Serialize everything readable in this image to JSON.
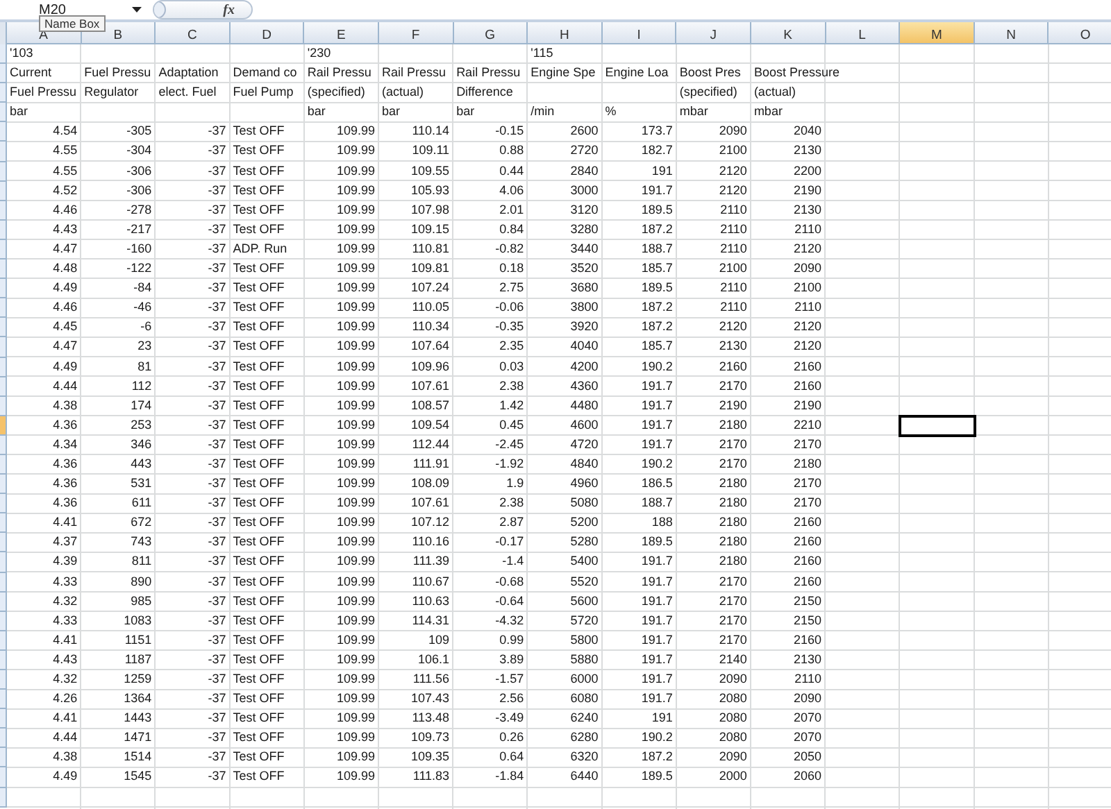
{
  "formula_bar": {
    "name_box": "M20",
    "function_label": "fx"
  },
  "tooltip": "Name Box",
  "columns": [
    {
      "label": "A",
      "selected": false
    },
    {
      "label": "B",
      "selected": false
    },
    {
      "label": "C",
      "selected": false
    },
    {
      "label": "D",
      "selected": false
    },
    {
      "label": "E",
      "selected": false
    },
    {
      "label": "F",
      "selected": false
    },
    {
      "label": "G",
      "selected": false
    },
    {
      "label": "H",
      "selected": false
    },
    {
      "label": "I",
      "selected": false
    },
    {
      "label": "J",
      "selected": false
    },
    {
      "label": "K",
      "selected": false
    },
    {
      "label": "L",
      "selected": false
    },
    {
      "label": "M",
      "selected": true
    },
    {
      "label": "N",
      "selected": false
    },
    {
      "label": "O",
      "selected": false
    }
  ],
  "rows": [
    {
      "selected": false,
      "cells": {
        "A": "'103",
        "E": "'230",
        "H": "'115"
      }
    },
    {
      "selected": false,
      "cells": {
        "A": "Current",
        "B": "Fuel Pressu",
        "C": "Adaptation",
        "D": "Demand co",
        "E": "Rail Pressu",
        "F": "Rail Pressu",
        "G": "Rail Pressu",
        "H": "Engine Spe",
        "I": "Engine Loa",
        "J": "Boost Pres",
        "K": "Boost Pressure"
      }
    },
    {
      "selected": false,
      "cells": {
        "A": "Fuel Pressu",
        "B": "Regulator",
        "C": "elect. Fuel",
        "D": "Fuel Pump",
        "E": "(specified)",
        "F": "(actual)",
        "G": "Difference",
        "J": "(specified)",
        "K": "(actual)"
      }
    },
    {
      "selected": false,
      "cells": {
        "A": "bar",
        "E": "bar",
        "F": "bar",
        "G": "bar",
        "H": "/min",
        "I": "%",
        "J": "mbar",
        "K": "mbar"
      }
    },
    {
      "selected": false,
      "cells": {
        "A": "4.54",
        "B": "-305",
        "C": "-37",
        "D": "Test OFF",
        "E": "109.99",
        "F": "110.14",
        "G": "-0.15",
        "H": "2600",
        "I": "173.7",
        "J": "2090",
        "K": "2040"
      }
    },
    {
      "selected": false,
      "cells": {
        "A": "4.55",
        "B": "-304",
        "C": "-37",
        "D": "Test OFF",
        "E": "109.99",
        "F": "109.11",
        "G": "0.88",
        "H": "2720",
        "I": "182.7",
        "J": "2100",
        "K": "2130"
      }
    },
    {
      "selected": false,
      "cells": {
        "A": "4.55",
        "B": "-306",
        "C": "-37",
        "D": "Test OFF",
        "E": "109.99",
        "F": "109.55",
        "G": "0.44",
        "H": "2840",
        "I": "191",
        "J": "2120",
        "K": "2200"
      }
    },
    {
      "selected": false,
      "cells": {
        "A": "4.52",
        "B": "-306",
        "C": "-37",
        "D": "Test OFF",
        "E": "109.99",
        "F": "105.93",
        "G": "4.06",
        "H": "3000",
        "I": "191.7",
        "J": "2120",
        "K": "2190"
      }
    },
    {
      "selected": false,
      "cells": {
        "A": "4.46",
        "B": "-278",
        "C": "-37",
        "D": "Test OFF",
        "E": "109.99",
        "F": "107.98",
        "G": "2.01",
        "H": "3120",
        "I": "189.5",
        "J": "2110",
        "K": "2130"
      }
    },
    {
      "selected": false,
      "cells": {
        "A": "4.43",
        "B": "-217",
        "C": "-37",
        "D": "Test OFF",
        "E": "109.99",
        "F": "109.15",
        "G": "0.84",
        "H": "3280",
        "I": "187.2",
        "J": "2110",
        "K": "2110"
      }
    },
    {
      "selected": false,
      "cells": {
        "A": "4.47",
        "B": "-160",
        "C": "-37",
        "D": "ADP. Run",
        "E": "109.99",
        "F": "110.81",
        "G": "-0.82",
        "H": "3440",
        "I": "188.7",
        "J": "2110",
        "K": "2120"
      }
    },
    {
      "selected": false,
      "cells": {
        "A": "4.48",
        "B": "-122",
        "C": "-37",
        "D": "Test OFF",
        "E": "109.99",
        "F": "109.81",
        "G": "0.18",
        "H": "3520",
        "I": "185.7",
        "J": "2100",
        "K": "2090"
      }
    },
    {
      "selected": false,
      "cells": {
        "A": "4.49",
        "B": "-84",
        "C": "-37",
        "D": "Test OFF",
        "E": "109.99",
        "F": "107.24",
        "G": "2.75",
        "H": "3680",
        "I": "189.5",
        "J": "2110",
        "K": "2100"
      }
    },
    {
      "selected": false,
      "cells": {
        "A": "4.46",
        "B": "-46",
        "C": "-37",
        "D": "Test OFF",
        "E": "109.99",
        "F": "110.05",
        "G": "-0.06",
        "H": "3800",
        "I": "187.2",
        "J": "2110",
        "K": "2110"
      }
    },
    {
      "selected": false,
      "cells": {
        "A": "4.45",
        "B": "-6",
        "C": "-37",
        "D": "Test OFF",
        "E": "109.99",
        "F": "110.34",
        "G": "-0.35",
        "H": "3920",
        "I": "187.2",
        "J": "2120",
        "K": "2120"
      }
    },
    {
      "selected": false,
      "cells": {
        "A": "4.47",
        "B": "23",
        "C": "-37",
        "D": "Test OFF",
        "E": "109.99",
        "F": "107.64",
        "G": "2.35",
        "H": "4040",
        "I": "185.7",
        "J": "2130",
        "K": "2120"
      }
    },
    {
      "selected": false,
      "cells": {
        "A": "4.49",
        "B": "81",
        "C": "-37",
        "D": "Test OFF",
        "E": "109.99",
        "F": "109.96",
        "G": "0.03",
        "H": "4200",
        "I": "190.2",
        "J": "2160",
        "K": "2160"
      }
    },
    {
      "selected": false,
      "cells": {
        "A": "4.44",
        "B": "112",
        "C": "-37",
        "D": "Test OFF",
        "E": "109.99",
        "F": "107.61",
        "G": "2.38",
        "H": "4360",
        "I": "191.7",
        "J": "2170",
        "K": "2160"
      }
    },
    {
      "selected": false,
      "cells": {
        "A": "4.38",
        "B": "174",
        "C": "-37",
        "D": "Test OFF",
        "E": "109.99",
        "F": "108.57",
        "G": "1.42",
        "H": "4480",
        "I": "191.7",
        "J": "2190",
        "K": "2190"
      }
    },
    {
      "selected": true,
      "cells": {
        "A": "4.36",
        "B": "253",
        "C": "-37",
        "D": "Test OFF",
        "E": "109.99",
        "F": "109.54",
        "G": "0.45",
        "H": "4600",
        "I": "191.7",
        "J": "2180",
        "K": "2210"
      }
    },
    {
      "selected": false,
      "cells": {
        "A": "4.34",
        "B": "346",
        "C": "-37",
        "D": "Test OFF",
        "E": "109.99",
        "F": "112.44",
        "G": "-2.45",
        "H": "4720",
        "I": "191.7",
        "J": "2170",
        "K": "2170"
      }
    },
    {
      "selected": false,
      "cells": {
        "A": "4.36",
        "B": "443",
        "C": "-37",
        "D": "Test OFF",
        "E": "109.99",
        "F": "111.91",
        "G": "-1.92",
        "H": "4840",
        "I": "190.2",
        "J": "2170",
        "K": "2180"
      }
    },
    {
      "selected": false,
      "cells": {
        "A": "4.36",
        "B": "531",
        "C": "-37",
        "D": "Test OFF",
        "E": "109.99",
        "F": "108.09",
        "G": "1.9",
        "H": "4960",
        "I": "186.5",
        "J": "2180",
        "K": "2170"
      }
    },
    {
      "selected": false,
      "cells": {
        "A": "4.36",
        "B": "611",
        "C": "-37",
        "D": "Test OFF",
        "E": "109.99",
        "F": "107.61",
        "G": "2.38",
        "H": "5080",
        "I": "188.7",
        "J": "2180",
        "K": "2170"
      }
    },
    {
      "selected": false,
      "cells": {
        "A": "4.41",
        "B": "672",
        "C": "-37",
        "D": "Test OFF",
        "E": "109.99",
        "F": "107.12",
        "G": "2.87",
        "H": "5200",
        "I": "188",
        "J": "2180",
        "K": "2160"
      }
    },
    {
      "selected": false,
      "cells": {
        "A": "4.37",
        "B": "743",
        "C": "-37",
        "D": "Test OFF",
        "E": "109.99",
        "F": "110.16",
        "G": "-0.17",
        "H": "5280",
        "I": "189.5",
        "J": "2180",
        "K": "2160"
      }
    },
    {
      "selected": false,
      "cells": {
        "A": "4.39",
        "B": "811",
        "C": "-37",
        "D": "Test OFF",
        "E": "109.99",
        "F": "111.39",
        "G": "-1.4",
        "H": "5400",
        "I": "191.7",
        "J": "2180",
        "K": "2160"
      }
    },
    {
      "selected": false,
      "cells": {
        "A": "4.33",
        "B": "890",
        "C": "-37",
        "D": "Test OFF",
        "E": "109.99",
        "F": "110.67",
        "G": "-0.68",
        "H": "5520",
        "I": "191.7",
        "J": "2170",
        "K": "2160"
      }
    },
    {
      "selected": false,
      "cells": {
        "A": "4.32",
        "B": "985",
        "C": "-37",
        "D": "Test OFF",
        "E": "109.99",
        "F": "110.63",
        "G": "-0.64",
        "H": "5600",
        "I": "191.7",
        "J": "2170",
        "K": "2150"
      }
    },
    {
      "selected": false,
      "cells": {
        "A": "4.33",
        "B": "1083",
        "C": "-37",
        "D": "Test OFF",
        "E": "109.99",
        "F": "114.31",
        "G": "-4.32",
        "H": "5720",
        "I": "191.7",
        "J": "2170",
        "K": "2150"
      }
    },
    {
      "selected": false,
      "cells": {
        "A": "4.41",
        "B": "1151",
        "C": "-37",
        "D": "Test OFF",
        "E": "109.99",
        "F": "109",
        "G": "0.99",
        "H": "5800",
        "I": "191.7",
        "J": "2170",
        "K": "2160"
      }
    },
    {
      "selected": false,
      "cells": {
        "A": "4.43",
        "B": "1187",
        "C": "-37",
        "D": "Test OFF",
        "E": "109.99",
        "F": "106.1",
        "G": "3.89",
        "H": "5880",
        "I": "191.7",
        "J": "2140",
        "K": "2130"
      }
    },
    {
      "selected": false,
      "cells": {
        "A": "4.32",
        "B": "1259",
        "C": "-37",
        "D": "Test OFF",
        "E": "109.99",
        "F": "111.56",
        "G": "-1.57",
        "H": "6000",
        "I": "191.7",
        "J": "2090",
        "K": "2110"
      }
    },
    {
      "selected": false,
      "cells": {
        "A": "4.26",
        "B": "1364",
        "C": "-37",
        "D": "Test OFF",
        "E": "109.99",
        "F": "107.43",
        "G": "2.56",
        "H": "6080",
        "I": "191.7",
        "J": "2080",
        "K": "2090"
      }
    },
    {
      "selected": false,
      "cells": {
        "A": "4.41",
        "B": "1443",
        "C": "-37",
        "D": "Test OFF",
        "E": "109.99",
        "F": "113.48",
        "G": "-3.49",
        "H": "6240",
        "I": "191",
        "J": "2080",
        "K": "2070"
      }
    },
    {
      "selected": false,
      "cells": {
        "A": "4.44",
        "B": "1471",
        "C": "-37",
        "D": "Test OFF",
        "E": "109.99",
        "F": "109.73",
        "G": "0.26",
        "H": "6280",
        "I": "190.2",
        "J": "2080",
        "K": "2070"
      }
    },
    {
      "selected": false,
      "cells": {
        "A": "4.38",
        "B": "1514",
        "C": "-37",
        "D": "Test OFF",
        "E": "109.99",
        "F": "109.35",
        "G": "0.64",
        "H": "6320",
        "I": "187.2",
        "J": "2090",
        "K": "2050"
      }
    },
    {
      "selected": false,
      "cells": {
        "A": "4.49",
        "B": "1545",
        "C": "-37",
        "D": "Test OFF",
        "E": "109.99",
        "F": "111.83",
        "G": "-1.84",
        "H": "6440",
        "I": "189.5",
        "J": "2000",
        "K": "2060"
      }
    }
  ]
}
